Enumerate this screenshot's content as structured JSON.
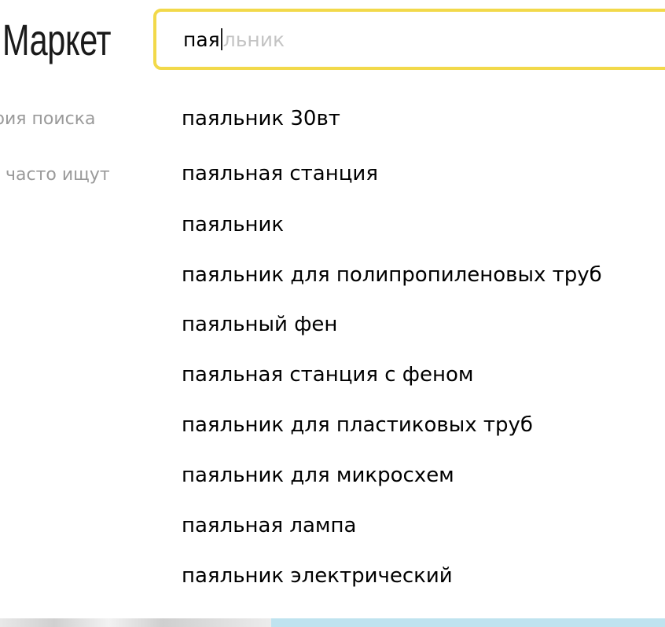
{
  "logo": {
    "text": "Маркет"
  },
  "search": {
    "typed": "пая",
    "completion_hint": "льник"
  },
  "sidebar": {
    "history_label": "рия поиска",
    "popular_label": "часто ищут"
  },
  "suggestions": [
    "паяльник 30вт",
    "паяльная станция",
    "паяльник",
    "паяльник для полипропиленовых труб",
    "паяльный фен",
    "паяльная станция с феном",
    "паяльник для пластиковых труб",
    "паяльник для микросхем",
    "паяльная лампа",
    "паяльник электрический"
  ],
  "colors": {
    "search_border": "#f2d94a",
    "hint_text": "#c4c4c4",
    "side_label": "#9a9a9a"
  }
}
